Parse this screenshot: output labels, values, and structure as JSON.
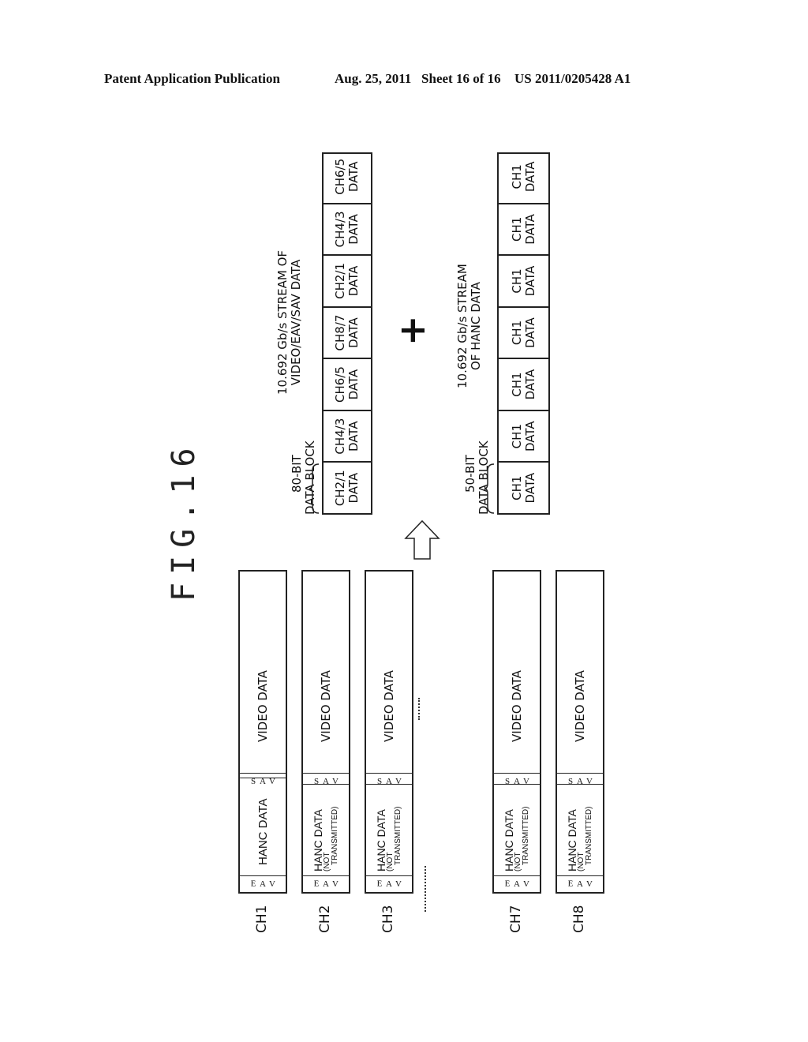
{
  "header": {
    "publication": "Patent Application Publication",
    "date_sheet": "Aug. 25, 2011   Sheet 16 of 16",
    "number": "US 2011/0205428 A1"
  },
  "figure": {
    "title": "FIG.16",
    "stream_video": {
      "label_line1": "10.692 Gb/s STREAM OF",
      "label_line2": "VIDEO/EAV/SAV DATA",
      "block_label_line1": "80-BIT",
      "block_label_line2": "DATA BLOCK",
      "cells": [
        {
          "line1": "CH2/1",
          "line2": "DATA"
        },
        {
          "line1": "CH4/3",
          "line2": "DATA"
        },
        {
          "line1": "CH6/5",
          "line2": "DATA"
        },
        {
          "line1": "CH8/7",
          "line2": "DATA"
        },
        {
          "line1": "CH2/1",
          "line2": "DATA"
        },
        {
          "line1": "CH4/3",
          "line2": "DATA"
        },
        {
          "line1": "CH6/5",
          "line2": "DATA"
        }
      ]
    },
    "plus_symbol": "+",
    "stream_hanc": {
      "label_line1": "10.692 Gb/s STREAM",
      "label_line2": "OF HANC DATA",
      "block_label_line1": "50-BIT",
      "block_label_line2": "DATA BLOCK",
      "cells": [
        {
          "line1": "CH1",
          "line2": "DATA"
        },
        {
          "line1": "CH1",
          "line2": "DATA"
        },
        {
          "line1": "CH1",
          "line2": "DATA"
        },
        {
          "line1": "CH1",
          "line2": "DATA"
        },
        {
          "line1": "CH1",
          "line2": "DATA"
        },
        {
          "line1": "CH1",
          "line2": "DATA"
        },
        {
          "line1": "CH1",
          "line2": "DATA"
        }
      ]
    },
    "arrow": "up-arrow",
    "channels": [
      {
        "name": "CH1",
        "eav": [
          "E",
          "A",
          "V"
        ],
        "hanc": "HANC DATA",
        "hanc_note1": "",
        "hanc_note2": "",
        "sav": [
          "S",
          "A",
          "V"
        ],
        "video": "VIDEO DATA"
      },
      {
        "name": "CH2",
        "eav": [
          "E",
          "A",
          "V"
        ],
        "hanc": "HANC DATA",
        "hanc_note1": "(NOT",
        "hanc_note2": "TRANSMITTED)",
        "sav": [
          "S",
          "A",
          "V"
        ],
        "video": "VIDEO DATA"
      },
      {
        "name": "CH3",
        "eav": [
          "E",
          "A",
          "V"
        ],
        "hanc": "HANC DATA",
        "hanc_note1": "(NOT",
        "hanc_note2": "TRANSMITTED)",
        "sav": [
          "S",
          "A",
          "V"
        ],
        "video": "VIDEO DATA"
      },
      {
        "name": "CH7",
        "eav": [
          "E",
          "A",
          "V"
        ],
        "hanc": "HANC DATA",
        "hanc_note1": "(NOT",
        "hanc_note2": "TRANSMITTED)",
        "sav": [
          "S",
          "A",
          "V"
        ],
        "video": "VIDEO DATA"
      },
      {
        "name": "CH8",
        "eav": [
          "E",
          "A",
          "V"
        ],
        "hanc": "HANC DATA",
        "hanc_note1": "(NOT",
        "hanc_note2": "TRANSMITTED)",
        "sav": [
          "S",
          "A",
          "V"
        ],
        "video": "VIDEO DATA"
      }
    ]
  }
}
